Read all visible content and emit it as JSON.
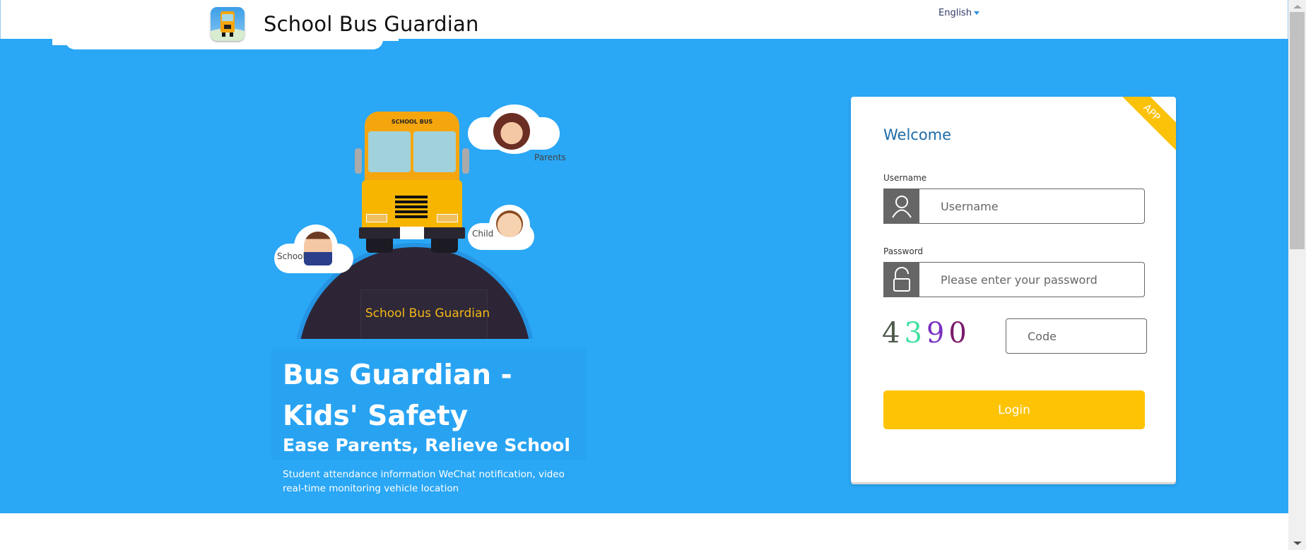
{
  "header": {
    "title": "School Bus Guardian",
    "language": "English",
    "logo_icon": "school-bus-app-icon"
  },
  "illustration": {
    "bus_sign": "SCHOOL BUS",
    "hill_label": "School Bus Guardian",
    "bubbles": [
      {
        "label": "Parents",
        "icon": "parent-avatar"
      },
      {
        "label": "Child",
        "icon": "child-avatar"
      },
      {
        "label": "School",
        "icon": "teacher-avatar"
      }
    ]
  },
  "hero": {
    "title": "Bus Guardian - Kids' Safety",
    "subtitle": "Ease Parents, Relieve School",
    "description": "Student attendance information WeChat notification, video real-time monitoring vehicle location"
  },
  "login": {
    "ribbon": "APP",
    "welcome": "Welcome",
    "username_label": "Username",
    "username_placeholder": "Username",
    "username_value": "",
    "password_label": "Password",
    "password_placeholder": "Please enter your password",
    "password_value": "",
    "captcha_digits": [
      "4",
      "3",
      "9",
      "0"
    ],
    "captcha_colors": [
      "#4d5a4a",
      "#3fe0a0",
      "#7a2fc0",
      "#7a1a6a"
    ],
    "code_placeholder": "Code",
    "code_value": "",
    "login_button": "Login"
  },
  "colors": {
    "brand_blue": "#2aa7f5",
    "accent_yellow": "#fec304",
    "welcome_blue": "#1c6aa6"
  }
}
